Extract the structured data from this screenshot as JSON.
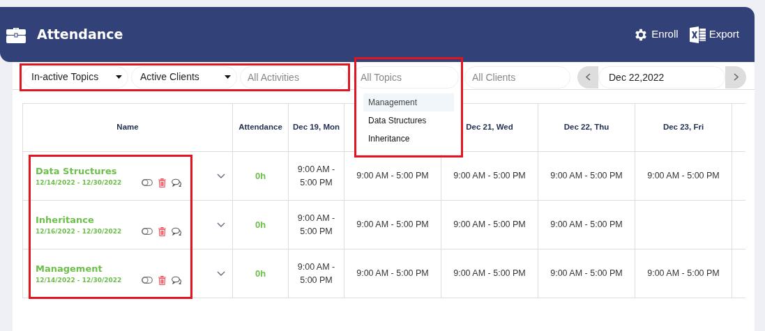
{
  "header": {
    "title": "Attendance",
    "actions": [
      {
        "label": "Enroll",
        "kind": "gear"
      },
      {
        "label": "Export",
        "kind": "excel"
      }
    ]
  },
  "filters": {
    "highlighted": true,
    "items": [
      {
        "kind": "select",
        "value": "In-active Topics"
      },
      {
        "kind": "select",
        "value": "Active Clients"
      },
      {
        "kind": "search",
        "placeholder": "All Activities"
      }
    ]
  },
  "topic_search": {
    "placeholder": "All Topics",
    "highlighted": true,
    "options": [
      {
        "label": "Management",
        "selected": true
      },
      {
        "label": "Data Structures",
        "selected": false
      },
      {
        "label": "Inheritance",
        "selected": false
      }
    ]
  },
  "client_search": {
    "placeholder": "All Clients"
  },
  "date_picker": {
    "value": "Dec 22,2022"
  },
  "table": {
    "name_highlighted": true,
    "name_header": "Name",
    "columns": [
      {
        "label": "Attendance",
        "kind": "hours"
      },
      {
        "label": "Dec 19, Mon",
        "kind": "time"
      },
      null,
      {
        "label": "Dec 21, Wed",
        "kind": "time"
      },
      {
        "label": "Dec 22, Thu",
        "kind": "time"
      },
      {
        "label": "Dec 23, Fri",
        "kind": "time"
      }
    ],
    "rows": [
      {
        "name": "Data Structures",
        "dates": "12/14/2022 - 12/30/2022",
        "cells": [
          "0h",
          "9:00 AM - 5:00 PM",
          "9:00 AM - 5:00 PM",
          "9:00 AM - 5:00 PM",
          "9:00 AM - 5:00 PM",
          "9:00 AM - 5:00 PM"
        ]
      },
      {
        "name": "Inheritance",
        "dates": "12/16/2022 - 12/30/2022",
        "cells": [
          "0h",
          "9:00 AM - 5:00 PM",
          "9:00 AM - 5:00 PM",
          "9:00 AM - 5:00 PM",
          "9:00 AM - 5:00 PM",
          null
        ]
      },
      {
        "name": "Management",
        "dates": "12/14/2022 - 12/30/2022",
        "cells": [
          "0h",
          "9:00 AM - 5:00 PM",
          "9:00 AM - 5:00 PM",
          "9:00 AM - 5:00 PM",
          "9:00 AM - 5:00 PM",
          "9:00 AM - 5:00 PM"
        ]
      }
    ]
  }
}
